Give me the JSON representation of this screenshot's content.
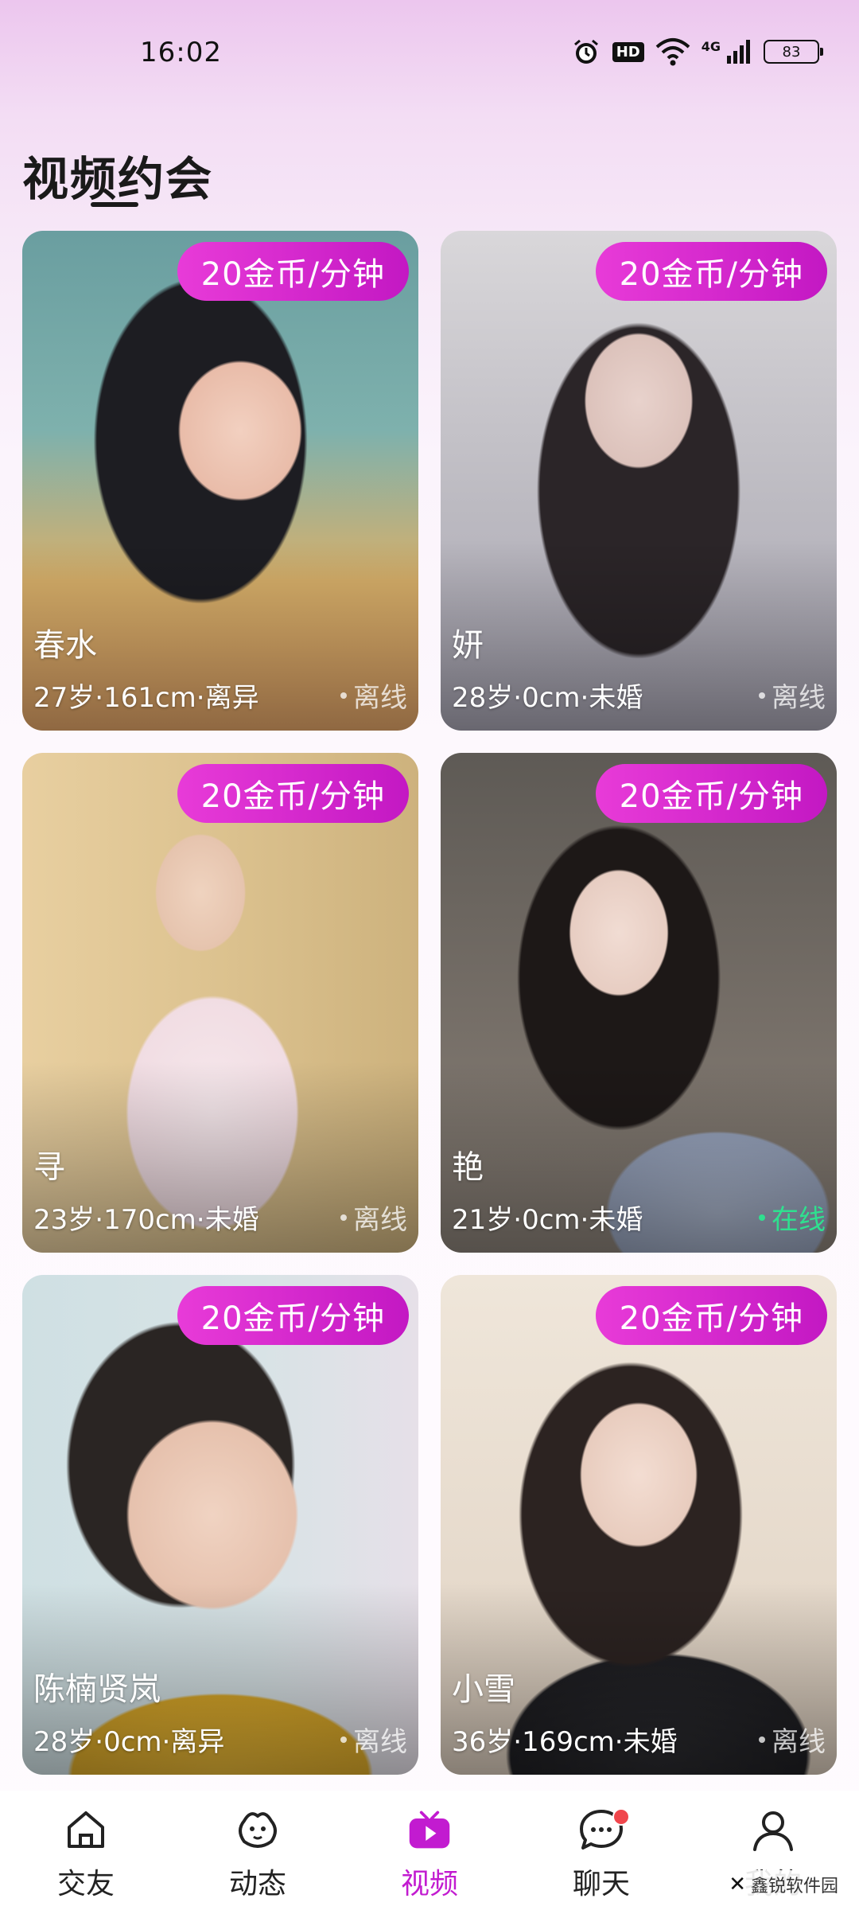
{
  "status_bar": {
    "time": "16:02",
    "hd": "HD",
    "network": "4G",
    "battery": "83"
  },
  "header": {
    "title": "视频约会"
  },
  "cards": [
    {
      "price": "20金币/分钟",
      "name": "春水",
      "info": "27岁·161cm·离异",
      "status": "离线"
    },
    {
      "price": "20金币/分钟",
      "name": "妍",
      "info": "28岁·0cm·未婚",
      "status": "离线"
    },
    {
      "price": "20金币/分钟",
      "name": "寻",
      "info": "23岁·170cm·未婚",
      "status": "离线"
    },
    {
      "price": "20金币/分钟",
      "name": "艳",
      "info": "21岁·0cm·未婚",
      "status": "在线"
    },
    {
      "price": "20金币/分钟",
      "name": "陈楠贤岚",
      "info": "28岁·0cm·离异",
      "status": "离线"
    },
    {
      "price": "20金币/分钟",
      "name": "小雪",
      "info": "36岁·169cm·未婚",
      "status": "离线"
    }
  ],
  "bottom_nav": {
    "items": [
      {
        "label": "交友",
        "icon": "home-icon"
      },
      {
        "label": "动态",
        "icon": "moments-icon"
      },
      {
        "label": "视频",
        "icon": "video-icon"
      },
      {
        "label": "聊天",
        "icon": "chat-icon"
      },
      {
        "label": "我的",
        "icon": "profile-icon"
      }
    ],
    "active": "视频"
  },
  "watermark": {
    "text": "鑫锐软件园"
  },
  "colors": {
    "accent": "#c21bd0",
    "badge_start": "#e83bd8",
    "badge_end": "#c318c3",
    "online": "#2fe08f",
    "notification": "#f0464c"
  }
}
